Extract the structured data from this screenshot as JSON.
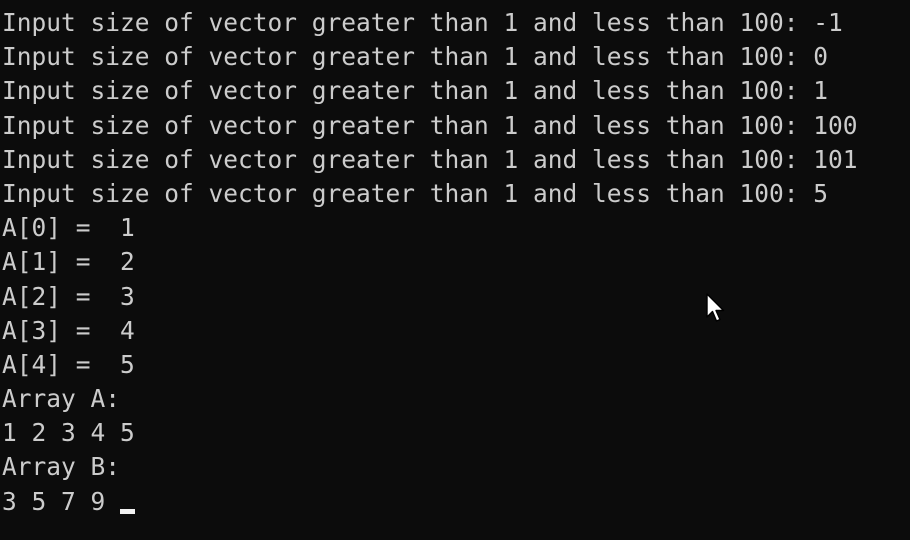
{
  "console": {
    "lines": [
      "Input size of vector greater than 1 and less than 100: -1",
      "Input size of vector greater than 1 and less than 100: 0",
      "Input size of vector greater than 1 and less than 100: 1",
      "Input size of vector greater than 1 and less than 100: 100",
      "Input size of vector greater than 1 and less than 100: 101",
      "Input size of vector greater than 1 and less than 100: 5",
      "A[0] =  1",
      "A[1] =  2",
      "A[2] =  3",
      "A[3] =  4",
      "A[4] =  5",
      "Array A:",
      "1 2 3 4 5",
      "Array B:",
      "3 5 7 9 "
    ]
  },
  "colors": {
    "background": "#0c0c0c",
    "text": "#cccccc",
    "cursor": "#f2f2f2"
  },
  "icons": {
    "pointer": "mouse-pointer-icon"
  }
}
